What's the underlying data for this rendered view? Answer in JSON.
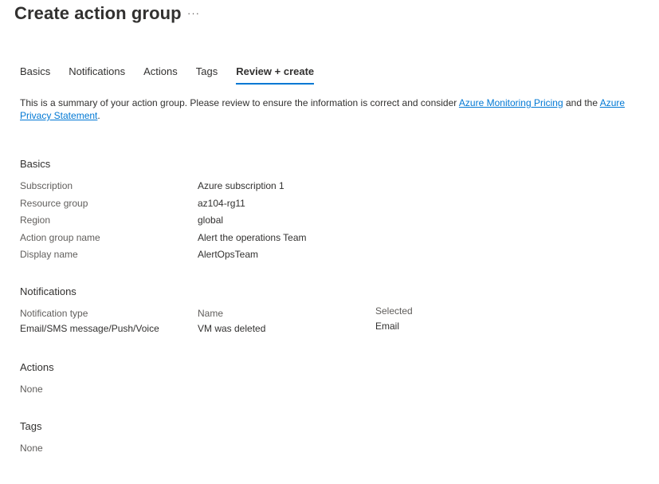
{
  "header": {
    "title": "Create action group",
    "more_label": "···"
  },
  "tabs": [
    {
      "label": "Basics"
    },
    {
      "label": "Notifications"
    },
    {
      "label": "Actions"
    },
    {
      "label": "Tags"
    },
    {
      "label": "Review + create",
      "active": true
    }
  ],
  "summary": {
    "text_before": "This is a summary of your action group. Please review to ensure the information is correct and consider ",
    "link_pricing": "Azure Monitoring Pricing",
    "text_middle": " and the ",
    "link_privacy": "Azure Privacy Statement",
    "text_after": "."
  },
  "basics": {
    "heading": "Basics",
    "rows": [
      {
        "label": "Subscription",
        "value": "Azure subscription 1"
      },
      {
        "label": "Resource group",
        "value": "az104-rg11"
      },
      {
        "label": "Region",
        "value": "global"
      },
      {
        "label": "Action group name",
        "value": "Alert the operations Team"
      },
      {
        "label": "Display name",
        "value": "AlertOpsTeam"
      }
    ]
  },
  "notifications": {
    "heading": "Notifications",
    "col_type": "Notification type",
    "col_name": "Name",
    "col_selected": "Selected",
    "row": {
      "type": "Email/SMS message/Push/Voice",
      "name": "VM was deleted",
      "selected": "Email"
    }
  },
  "actions": {
    "heading": "Actions",
    "value": "None"
  },
  "tags": {
    "heading": "Tags",
    "value": "None"
  },
  "colors": {
    "accent": "#0078d4",
    "text": "#323130",
    "muted": "#605e5c"
  }
}
